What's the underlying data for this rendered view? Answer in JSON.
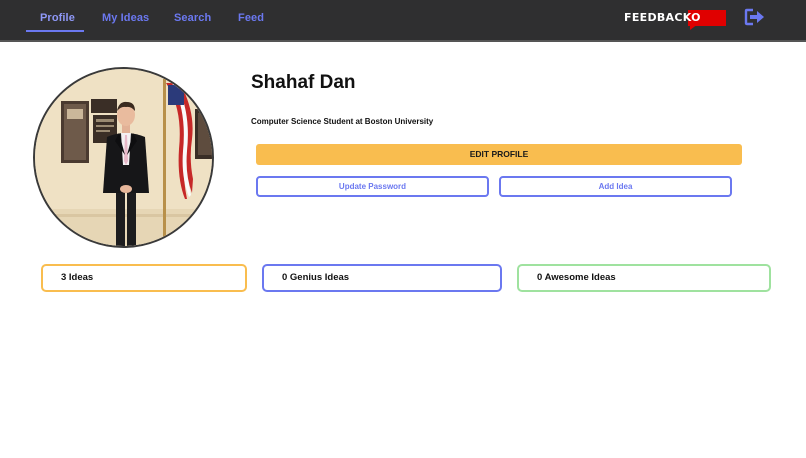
{
  "nav": {
    "items": [
      {
        "label": "Profile"
      },
      {
        "label": "My Ideas"
      },
      {
        "label": "Search"
      },
      {
        "label": "Feed"
      }
    ],
    "active": "Profile",
    "brand": "FEEDBACKO",
    "logout_icon": "logout-icon"
  },
  "profile": {
    "name": "Shahaf Dan",
    "bio": "Computer Science Student at Boston University",
    "edit_label": "EDIT PROFILE",
    "update_password_label": "Update Password",
    "add_idea_label": "Add Idea"
  },
  "stats": {
    "ideas": "3 Ideas",
    "genius": "0 Genius Ideas",
    "awesome": "0 Awesome Ideas"
  },
  "colors": {
    "nav_bg": "#2f2f30",
    "accent": "#6b78f0",
    "edit_button": "#f9bd4f",
    "brand_red": "#e00000",
    "awesome_border": "#9fe29f"
  }
}
